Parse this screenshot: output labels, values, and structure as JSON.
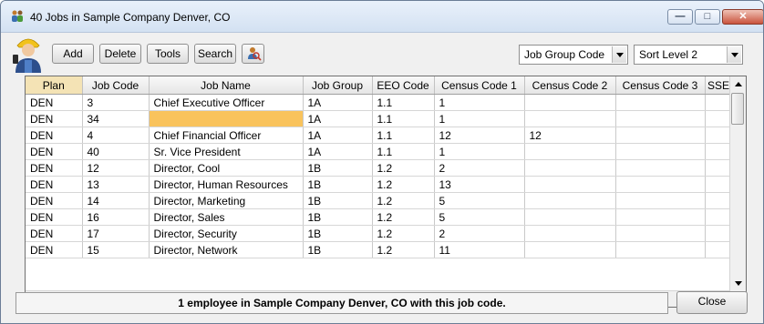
{
  "window": {
    "title": "40 Jobs in Sample Company Denver, CO",
    "controls": {
      "minimize": "—",
      "maximize": "□",
      "close": "✕"
    }
  },
  "toolbar": {
    "add_label": "Add",
    "delete_label": "Delete",
    "tools_label": "Tools",
    "search_label": "Search",
    "group_combo_value": "Job Group Code",
    "sort_combo_value": "Sort Level 2"
  },
  "grid": {
    "columns": [
      "Plan",
      "Job Code",
      "Job Name",
      "Job Group",
      "EEO Code",
      "Census Code 1",
      "Census Code 2",
      "Census Code 3",
      "SSE"
    ],
    "rows": [
      [
        "DEN",
        "3",
        "Chief Executive Officer",
        "1A",
        "1.1",
        "1",
        "",
        "",
        ""
      ],
      [
        "DEN",
        "34",
        "",
        "1A",
        "1.1",
        "1",
        "",
        "",
        ""
      ],
      [
        "DEN",
        "4",
        "Chief Financial Officer",
        "1A",
        "1.1",
        "12",
        "12",
        "",
        ""
      ],
      [
        "DEN",
        "40",
        "Sr. Vice President",
        "1A",
        "1.1",
        "1",
        "",
        "",
        ""
      ],
      [
        "DEN",
        "12",
        "Director, Cool",
        "1B",
        "1.2",
        "2",
        "",
        "",
        ""
      ],
      [
        "DEN",
        "13",
        "Director, Human Resources",
        "1B",
        "1.2",
        "13",
        "",
        "",
        ""
      ],
      [
        "DEN",
        "14",
        "Director, Marketing",
        "1B",
        "1.2",
        "5",
        "",
        "",
        ""
      ],
      [
        "DEN",
        "16",
        "Director, Sales",
        "1B",
        "1.2",
        "5",
        "",
        "",
        ""
      ],
      [
        "DEN",
        "17",
        "Director, Security",
        "1B",
        "1.2",
        "2",
        "",
        "",
        ""
      ],
      [
        "DEN",
        "15",
        "Director, Network",
        "1B",
        "1.2",
        "11",
        "",
        "",
        ""
      ]
    ],
    "highlight_color": "#f9c35c"
  },
  "status_text": "1 employee in Sample Company Denver, CO with this job code.",
  "close_label": "Close",
  "icons": {
    "app": "people-icon",
    "avatar": "worker-avatar-icon",
    "find": "find-person-icon"
  }
}
